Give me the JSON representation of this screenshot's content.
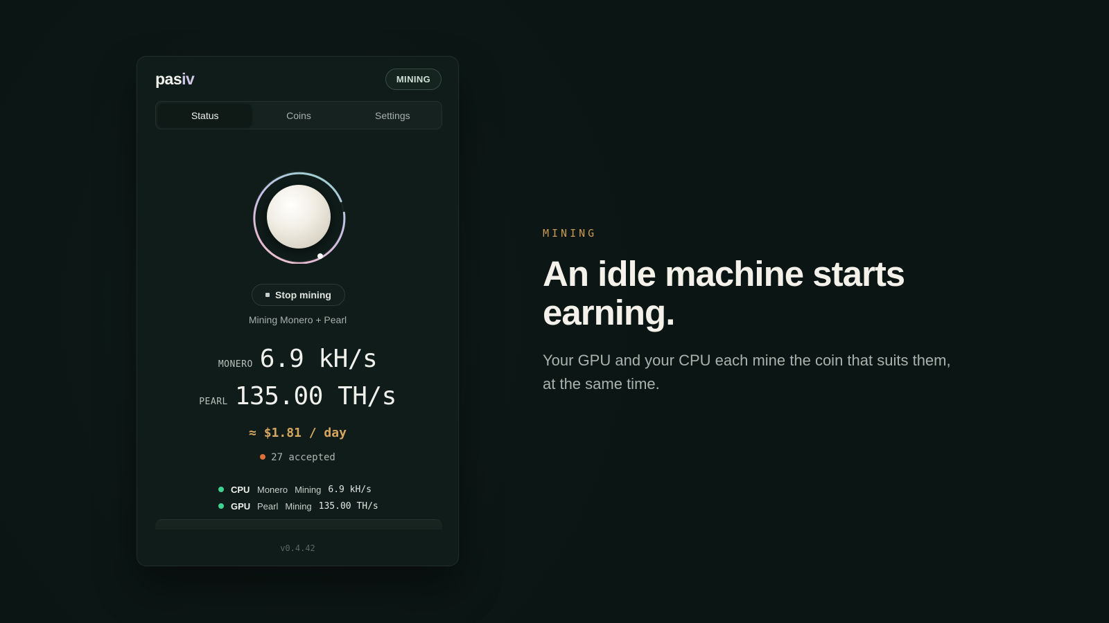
{
  "app": {
    "logo_main": "pas",
    "logo_accent": "iv",
    "badge": "MINING",
    "tabs": [
      {
        "label": "Status",
        "active": true
      },
      {
        "label": "Coins",
        "active": false
      },
      {
        "label": "Settings",
        "active": false
      }
    ],
    "stop_button": "Stop mining",
    "mining_text": "Mining Monero + Pearl",
    "rates": {
      "monero_label": "MONERO",
      "monero_value": "6.9 kH/s",
      "pearl_label": "PEARL",
      "pearl_value": "135.00 TH/s"
    },
    "earnings": "≈ $1.81 / day",
    "accepted": "27 accepted",
    "workers": [
      {
        "device": "CPU",
        "coin": "Monero",
        "status": "Mining",
        "rate": "6.9 kH/s"
      },
      {
        "device": "GPU",
        "coin": "Pearl",
        "status": "Mining",
        "rate": "135.00 TH/s"
      }
    ],
    "version": "v0.4.42"
  },
  "marketing": {
    "eyebrow": "MINING",
    "headline_line1": "An idle machine starts",
    "headline_line2": "earning.",
    "subtext_line1": "Your GPU and your CPU each mine the coin that suits them,",
    "subtext_line2": "at the same time."
  },
  "colors": {
    "background": "#0d1816",
    "panel": "#0f1c19",
    "accent_gold": "#d6a760",
    "status_green": "#3fd38f",
    "accepted_orange": "#e0703a"
  },
  "icons": {
    "stop": "stop-square-icon",
    "status_dot": "status-dot-icon"
  }
}
